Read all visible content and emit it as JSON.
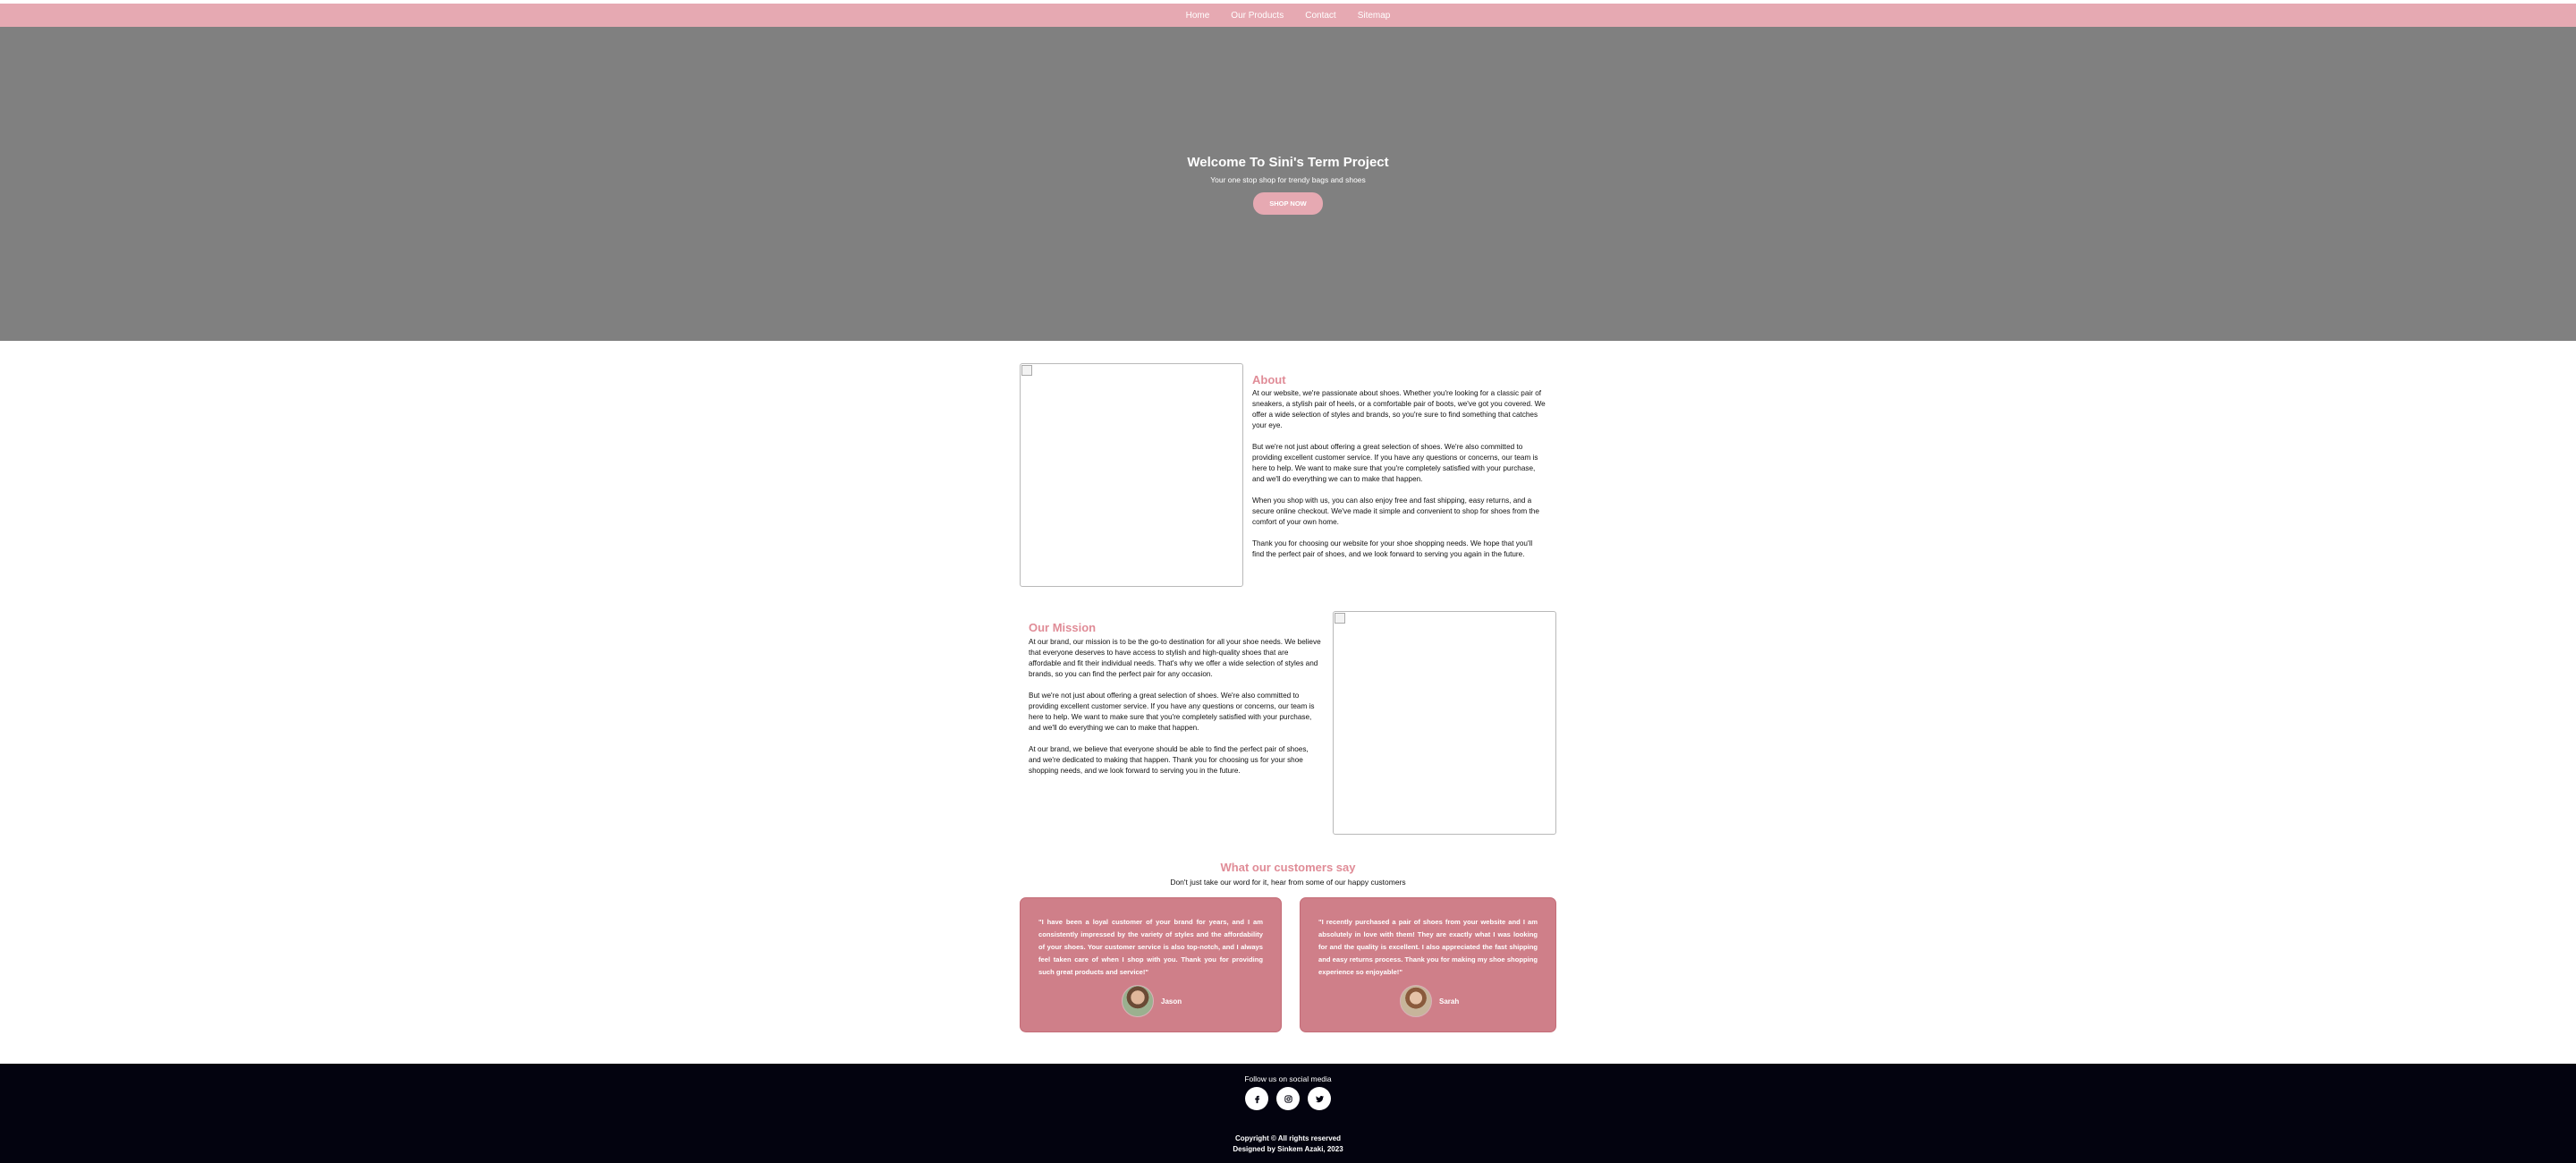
{
  "nav": {
    "links": [
      "Home",
      "Our Products",
      "Contact",
      "Sitemap"
    ]
  },
  "hero": {
    "title": "Welcome To Sini's Term Project",
    "subtitle": "Your one stop shop for trendy bags and shoes",
    "button": "SHOP NOW"
  },
  "about": {
    "title": "About",
    "paragraphs": [
      "At our website, we're passionate about shoes. Whether you're looking for a classic pair of sneakers, a stylish pair of heels, or a comfortable pair of boots, we've got you covered. We offer a wide selection of styles and brands, so you're sure to find something that catches your eye.",
      "But we're not just about offering a great selection of shoes. We're also committed to providing excellent customer service. If you have any questions or concerns, our team is here to help. We want to make sure that you're completely satisfied with your purchase, and we'll do everything we can to make that happen.",
      "When you shop with us, you can also enjoy free and fast shipping, easy returns, and a secure online checkout. We've made it simple and convenient to shop for shoes from the comfort of your own home.",
      "Thank you for choosing our website for your shoe shopping needs. We hope that you'll find the perfect pair of shoes, and we look forward to serving you again in the future."
    ]
  },
  "mission": {
    "title": "Our Mission",
    "paragraphs": [
      "At our brand, our mission is to be the go-to destination for all your shoe needs. We believe that everyone deserves to have access to stylish and high-quality shoes that are affordable and fit their individual needs. That's why we offer a wide selection of styles and brands, so you can find the perfect pair for any occasion.",
      "But we're not just about offering a great selection of shoes. We're also committed to providing excellent customer service. If you have any questions or concerns, our team is here to help. We want to make sure that you're completely satisfied with your purchase, and we'll do everything we can to make that happen.",
      "At our brand, we believe that everyone should be able to find the perfect pair of shoes, and we're dedicated to making that happen. Thank you for choosing us for your shoe shopping needs, and we look forward to serving you in the future."
    ]
  },
  "testimonials": {
    "title": "What our customers say",
    "subtitle": "Don't just take our word for it, hear from some of our happy customers",
    "items": [
      {
        "quote": "\"I have been a loyal customer of your brand for years, and I am consistently impressed by the variety of styles and the affordability of your shoes. Your customer service is also top-notch, and I always feel taken care of when I shop with you. Thank you for providing such great products and service!\"",
        "name": "Jason"
      },
      {
        "quote": "\"I recently purchased a pair of shoes from your website and I am absolutely in love with them! They are exactly what I was looking for and the quality is excellent. I also appreciated the fast shipping and easy returns process. Thank you for making my shoe shopping experience so enjoyable!\"",
        "name": "Sarah"
      }
    ]
  },
  "footer": {
    "follow": "Follow us on social media",
    "socials": [
      "facebook-icon",
      "instagram-icon",
      "twitter-icon"
    ],
    "copyright": "Copyright © All rights reserved",
    "designed_by": "Designed by Sinkem Azaki, 2023"
  },
  "colors": {
    "nav_bg": "#e6a9b2",
    "hero_bg": "#808080",
    "accent": "#e08c97",
    "card_bg": "#cf7f89",
    "footer_bg": "#03030f"
  }
}
